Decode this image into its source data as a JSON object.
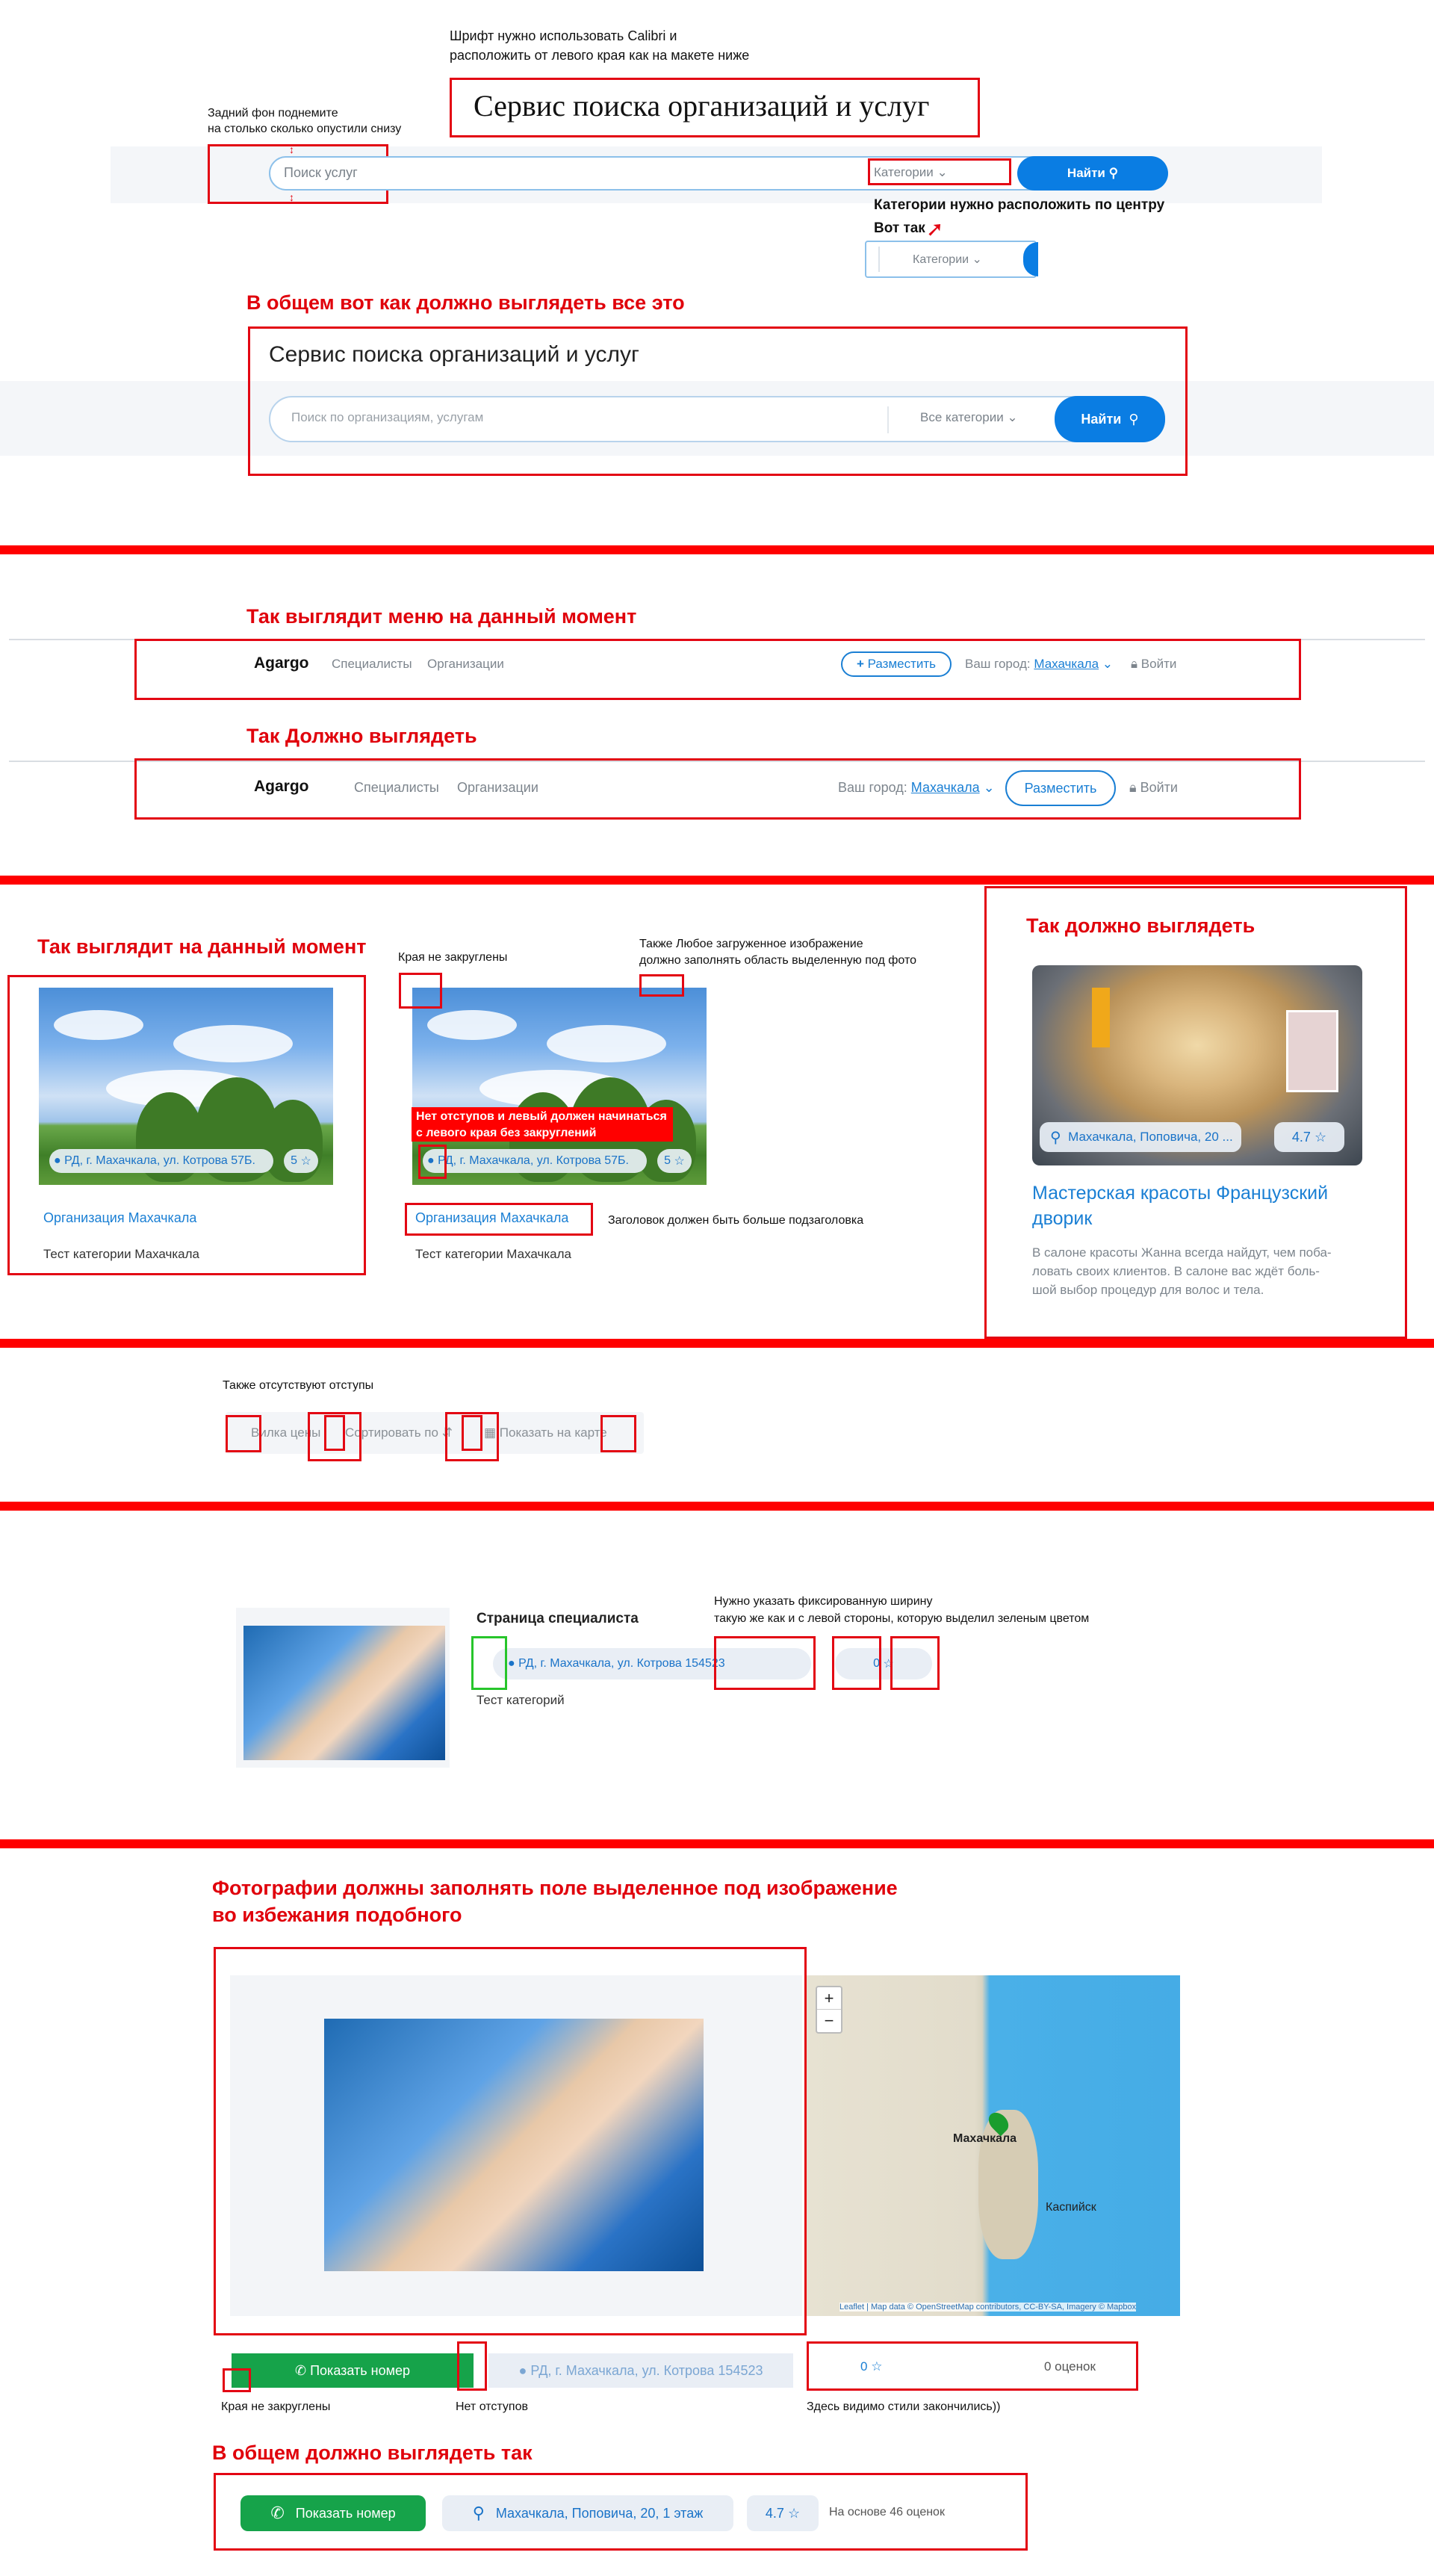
{
  "section1": {
    "font_note_line1": "Шрифт нужно использовать Calibri и",
    "font_note_line2": "расположить от левого края как на макете ниже",
    "title_current": "Сервис поиска организаций и услуг",
    "bg_note_line1": "Задний фон поднемите",
    "bg_note_line2": "на столько сколько опустили снизу",
    "search_placeholder_current": "Поиск услуг",
    "categories_current": "Категории",
    "find_current": "Найти",
    "categories_center_note": "Категории нужно расположить по центру",
    "like_this": "Вот так",
    "categories_example": "Категории",
    "overall_heading": "В общем вот как должно выглядеть все это",
    "title_target": "Сервис поиска организаций и услуг",
    "search_placeholder_target": "Поиск по организациям, услугам",
    "categories_target": "Все категории",
    "find_target": "Найти"
  },
  "section2": {
    "current_heading": "Так выглядит меню на данный момент",
    "target_heading": "Так Должно выглядеть",
    "logo": "Agargo",
    "nav_specialists": "Специалисты",
    "nav_organizations": "Организации",
    "place_button": "Разместить",
    "city_label": "Ваш город:",
    "city_value": "Махачкала",
    "login": "Войти"
  },
  "section3": {
    "current_heading": "Так выглядит на данный момент",
    "corners_note": "Края не закруглены",
    "image_note_line1": "Также Любое загруженное изображение",
    "image_note_line2": "должно заполнять область выделенную под фото",
    "target_heading": "Так должно выглядеть",
    "address_current": "РД, г. Махачкала, ул. Котрова 57Б.",
    "rating_current": "5",
    "org_title_current": "Организация Махачкала",
    "category_current": "Тест категории Махачкала",
    "no_padding_line1": "Нет отступов и левый должен начинаться",
    "no_padding_line2": "с левого края без закруглений",
    "heading_size_note": "Заголовок должен быть больше подзаголовка",
    "target_address": "Махачкала, Поповича, 20 ...",
    "target_rating": "4.7",
    "target_title_line1": "Мастерская красоты Французский",
    "target_title_line2": "дворик",
    "target_desc_line1": "В салоне красоты Жанна всегда найдут, чем поба-",
    "target_desc_line2": "ловать своих клиентов. В салоне вас ждёт боль-",
    "target_desc_line3": "шой выбор процедур для волос и тела."
  },
  "section4": {
    "note": "Также отсутствуют отступы",
    "price_fork": "Вилка цены",
    "sort_by": "Сортировать по",
    "show_on_map": "Показать на карте"
  },
  "section5": {
    "specialist_title": "Страница специалиста",
    "address": "РД, г. Махачкала, ул. Котрова 154523",
    "rating": "0",
    "category": "Тест категорий",
    "width_note_line1": "Нужно указать фиксированную ширину",
    "width_note_line2": "такую же как и с левой стороны, которую выделил зеленым цветом"
  },
  "section6": {
    "photo_heading_line1": "Фотографии должны заполнять поле выделенное под изображение",
    "photo_heading_line2": "во избежания подобного",
    "map_zoom_in": "+",
    "map_zoom_out": "−",
    "map_city1": "Махачкала",
    "map_city2": "Каспийск",
    "map_attribution": "Leaflet | Map data © OpenStreetMap contributors, CC-BY-SA, Imagery © Mapbox",
    "show_number_current": "Показать номер",
    "address_current": "РД, г. Махачкала, ул. Котрова 154523",
    "rating_current": "0",
    "reviews_current": "0 оценок",
    "corners_note": "Края не закруглены",
    "no_padding_note": "Нет отступов",
    "styles_note": "Здесь видимо стили закончились))",
    "overall_heading": "В общем должно выглядеть так",
    "show_number_target": "Показать номер",
    "address_target": "Махачкала, Поповича, 20, 1 этаж",
    "rating_target": "4.7",
    "reviews_target": "На основе 46 оценок"
  }
}
